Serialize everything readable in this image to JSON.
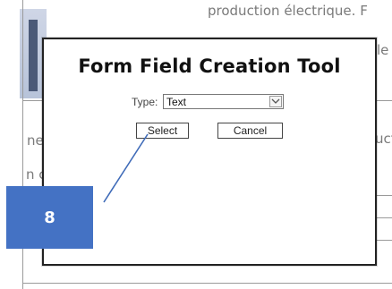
{
  "background": {
    "top_text": "production électrique. F",
    "right_text_1": "le",
    "right_text_2": "uct",
    "left_text_1": "ne",
    "left_text_2": "n c"
  },
  "dialog": {
    "title": "Form Field Creation Tool",
    "type_label": "Type:",
    "type_value": "Text",
    "select_button": "Select",
    "cancel_button": "Cancel"
  },
  "callout": {
    "number": "8",
    "color": "#4472c4"
  }
}
